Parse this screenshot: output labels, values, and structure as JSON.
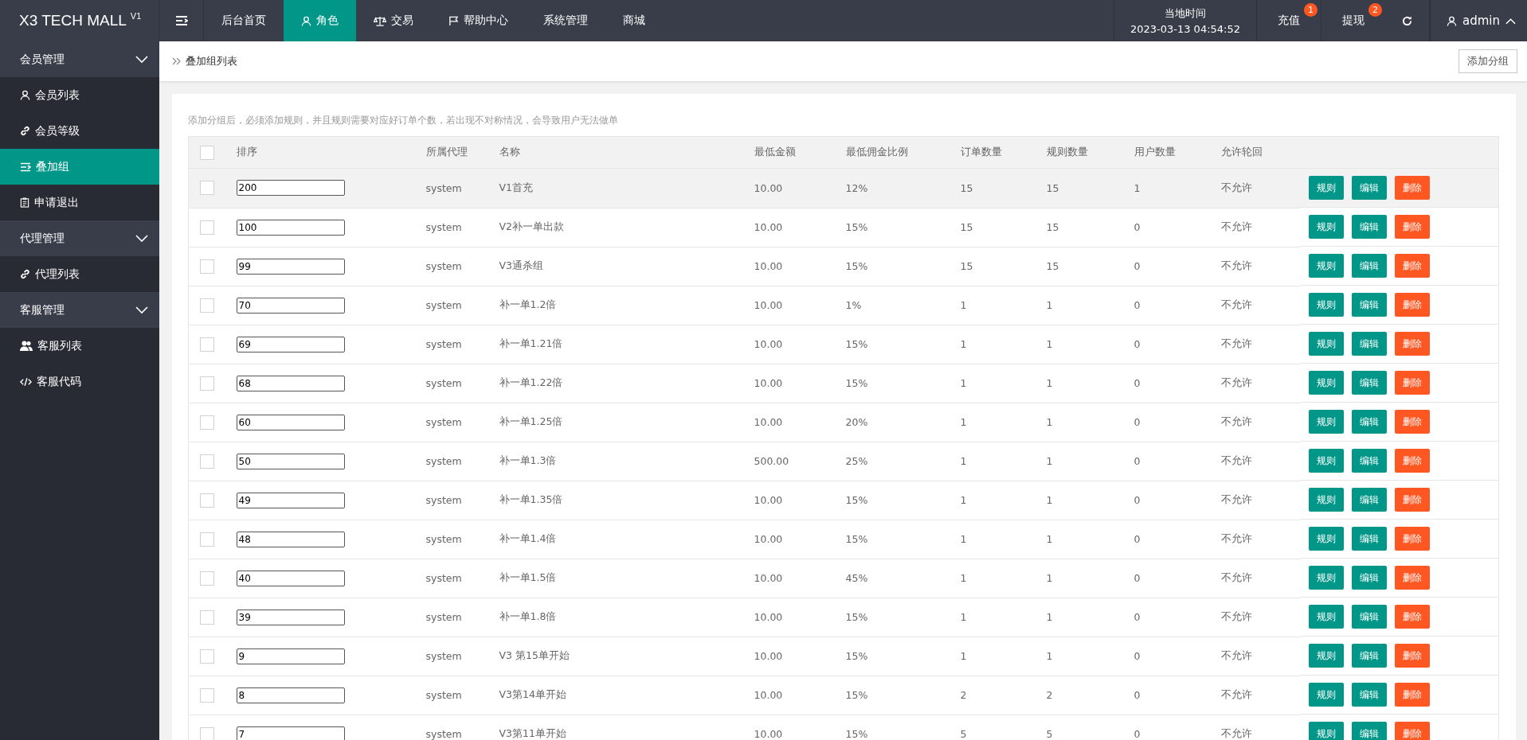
{
  "header": {
    "logo": "X3 TECH MALL",
    "logo_sup": "V1",
    "nav": [
      {
        "label": "后台首页",
        "selected": false
      },
      {
        "label": "角色",
        "selected": true
      },
      {
        "label": "交易",
        "selected": false
      },
      {
        "label": "帮助中心",
        "selected": false
      },
      {
        "label": "系统管理",
        "selected": false
      },
      {
        "label": "商城",
        "selected": false
      }
    ],
    "clock": {
      "label": "当地时间",
      "value": "2023-03-13 04:54:52"
    },
    "actions": [
      {
        "label": "充值",
        "badge": "1"
      },
      {
        "label": "提现",
        "badge": "2"
      }
    ],
    "user": "admin"
  },
  "sidebar": [
    {
      "label": "会员管理",
      "expanded": true,
      "children": [
        {
          "label": "会员列表",
          "selected": false
        },
        {
          "label": "会员等级",
          "selected": false
        },
        {
          "label": "叠加组",
          "selected": true
        },
        {
          "label": "申请退出",
          "selected": false
        }
      ]
    },
    {
      "label": "代理管理",
      "expanded": true,
      "children": [
        {
          "label": "代理列表",
          "selected": false
        }
      ]
    },
    {
      "label": "客服管理",
      "expanded": true,
      "children": [
        {
          "label": "客服列表",
          "selected": false
        },
        {
          "label": "客服代码",
          "selected": false
        }
      ]
    }
  ],
  "breadcrumb": "叠加组列表",
  "add_button": "添加分组",
  "notice": "添加分组后，必须添加规则，并且规则需要对应好订单个数，若出现不对称情况，会导致用户无法做单",
  "table": {
    "all_checked": false,
    "columns": [
      "排序",
      "所属代理",
      "名称",
      "最低金额",
      "最低佣金比例",
      "订单数量",
      "规则数量",
      "用户数量",
      "允许轮回"
    ],
    "rows": [
      {
        "checked": false,
        "selected": true,
        "cells": [
          "200",
          "system",
          "V1首充",
          "10.00",
          "12%",
          "15",
          "15",
          "1",
          "不允许"
        ],
        "actions": [
          {
            "label": "规则",
            "kind": "normal"
          },
          {
            "label": "编辑",
            "kind": "normal"
          },
          {
            "label": "删除",
            "kind": "danger"
          }
        ]
      },
      {
        "checked": false,
        "selected": false,
        "cells": [
          "100",
          "system",
          "V2补一单出款",
          "10.00",
          "15%",
          "15",
          "15",
          "0",
          "不允许"
        ],
        "actions": [
          {
            "label": "规则",
            "kind": "normal"
          },
          {
            "label": "编辑",
            "kind": "normal"
          },
          {
            "label": "删除",
            "kind": "danger"
          }
        ]
      },
      {
        "checked": false,
        "selected": false,
        "cells": [
          "99",
          "system",
          "V3通杀组",
          "10.00",
          "15%",
          "15",
          "15",
          "0",
          "不允许"
        ],
        "actions": [
          {
            "label": "规则",
            "kind": "normal"
          },
          {
            "label": "编辑",
            "kind": "normal"
          },
          {
            "label": "删除",
            "kind": "danger"
          }
        ]
      },
      {
        "checked": false,
        "selected": false,
        "cells": [
          "70",
          "system",
          "补一单1.2倍",
          "10.00",
          "1%",
          "1",
          "1",
          "0",
          "不允许"
        ],
        "actions": [
          {
            "label": "规则",
            "kind": "normal"
          },
          {
            "label": "编辑",
            "kind": "normal"
          },
          {
            "label": "删除",
            "kind": "danger"
          }
        ]
      },
      {
        "checked": false,
        "selected": false,
        "cells": [
          "69",
          "system",
          "补一单1.21倍",
          "10.00",
          "15%",
          "1",
          "1",
          "0",
          "不允许"
        ],
        "actions": [
          {
            "label": "规则",
            "kind": "normal"
          },
          {
            "label": "编辑",
            "kind": "normal"
          },
          {
            "label": "删除",
            "kind": "danger"
          }
        ]
      },
      {
        "checked": false,
        "selected": false,
        "cells": [
          "68",
          "system",
          "补一单1.22倍",
          "10.00",
          "15%",
          "1",
          "1",
          "0",
          "不允许"
        ],
        "actions": [
          {
            "label": "规则",
            "kind": "normal"
          },
          {
            "label": "编辑",
            "kind": "normal"
          },
          {
            "label": "删除",
            "kind": "danger"
          }
        ]
      },
      {
        "checked": false,
        "selected": false,
        "cells": [
          "60",
          "system",
          "补一单1.25倍",
          "10.00",
          "20%",
          "1",
          "1",
          "0",
          "不允许"
        ],
        "actions": [
          {
            "label": "规则",
            "kind": "normal"
          },
          {
            "label": "编辑",
            "kind": "normal"
          },
          {
            "label": "删除",
            "kind": "danger"
          }
        ]
      },
      {
        "checked": false,
        "selected": false,
        "cells": [
          "50",
          "system",
          "补一单1.3倍",
          "500.00",
          "25%",
          "1",
          "1",
          "0",
          "不允许"
        ],
        "actions": [
          {
            "label": "规则",
            "kind": "normal"
          },
          {
            "label": "编辑",
            "kind": "normal"
          },
          {
            "label": "删除",
            "kind": "danger"
          }
        ]
      },
      {
        "checked": false,
        "selected": false,
        "cells": [
          "49",
          "system",
          "补一单1.35倍",
          "10.00",
          "15%",
          "1",
          "1",
          "0",
          "不允许"
        ],
        "actions": [
          {
            "label": "规则",
            "kind": "normal"
          },
          {
            "label": "编辑",
            "kind": "normal"
          },
          {
            "label": "删除",
            "kind": "danger"
          }
        ]
      },
      {
        "checked": false,
        "selected": false,
        "cells": [
          "48",
          "system",
          "补一单1.4倍",
          "10.00",
          "15%",
          "1",
          "1",
          "0",
          "不允许"
        ],
        "actions": [
          {
            "label": "规则",
            "kind": "normal"
          },
          {
            "label": "编辑",
            "kind": "normal"
          },
          {
            "label": "删除",
            "kind": "danger"
          }
        ]
      },
      {
        "checked": false,
        "selected": false,
        "cells": [
          "40",
          "system",
          "补一单1.5倍",
          "10.00",
          "45%",
          "1",
          "1",
          "0",
          "不允许"
        ],
        "actions": [
          {
            "label": "规则",
            "kind": "normal"
          },
          {
            "label": "编辑",
            "kind": "normal"
          },
          {
            "label": "删除",
            "kind": "danger"
          }
        ]
      },
      {
        "checked": false,
        "selected": false,
        "cells": [
          "39",
          "system",
          "补一单1.8倍",
          "10.00",
          "15%",
          "1",
          "1",
          "0",
          "不允许"
        ],
        "actions": [
          {
            "label": "规则",
            "kind": "normal"
          },
          {
            "label": "编辑",
            "kind": "normal"
          },
          {
            "label": "删除",
            "kind": "danger"
          }
        ]
      },
      {
        "checked": false,
        "selected": false,
        "cells": [
          "9",
          "system",
          "V3 第15单开始",
          "10.00",
          "15%",
          "1",
          "1",
          "0",
          "不允许"
        ],
        "actions": [
          {
            "label": "规则",
            "kind": "normal"
          },
          {
            "label": "编辑",
            "kind": "normal"
          },
          {
            "label": "删除",
            "kind": "danger"
          }
        ]
      },
      {
        "checked": false,
        "selected": false,
        "cells": [
          "8",
          "system",
          "V3第14单开始",
          "10.00",
          "15%",
          "2",
          "2",
          "0",
          "不允许"
        ],
        "actions": [
          {
            "label": "规则",
            "kind": "normal"
          },
          {
            "label": "编辑",
            "kind": "normal"
          },
          {
            "label": "删除",
            "kind": "danger"
          }
        ]
      },
      {
        "checked": false,
        "selected": false,
        "cells": [
          "7",
          "system",
          "V3第11单开始",
          "10.00",
          "15%",
          "5",
          "5",
          "0",
          "不允许"
        ],
        "actions": [
          {
            "label": "规则",
            "kind": "normal"
          },
          {
            "label": "编辑",
            "kind": "normal"
          },
          {
            "label": "删除",
            "kind": "danger"
          }
        ]
      }
    ]
  }
}
